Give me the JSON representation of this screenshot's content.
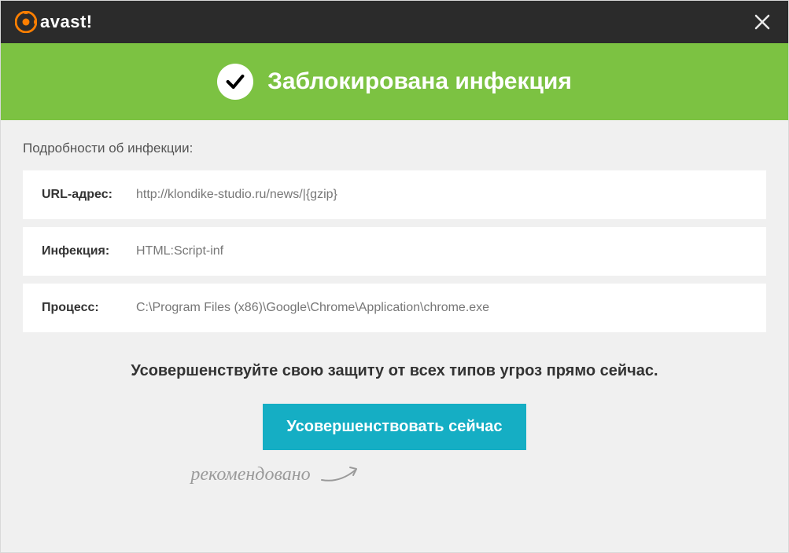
{
  "brand": {
    "name": "avast!"
  },
  "banner": {
    "title": "Заблокирована инфекция"
  },
  "details": {
    "heading": "Подробности об инфекции:",
    "url_label": "URL-адрес:",
    "url_value": "http://klondike-studio.ru/news/|{gzip}",
    "infection_label": "Инфекция:",
    "infection_value": "HTML:Script-inf",
    "process_label": "Процесс:",
    "process_value": "C:\\Program Files (x86)\\Google\\Chrome\\Application\\chrome.exe"
  },
  "upgrade": {
    "heading": "Усовершенствуйте свою защиту от всех типов угроз прямо сейчас.",
    "cta_label": "Усовершенствовать сейчас",
    "recommend_text": "рекомендовано"
  }
}
